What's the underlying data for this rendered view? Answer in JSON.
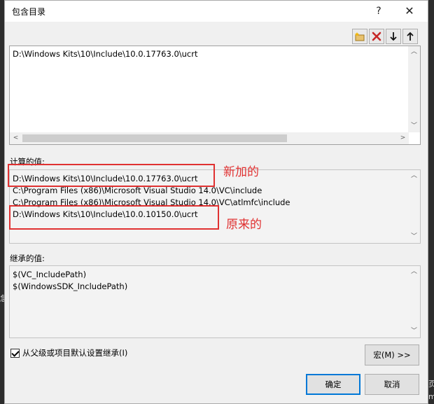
{
  "window": {
    "title": "包含目录",
    "help_label": "?",
    "close_label": "✕"
  },
  "toolbar": [
    {
      "name": "new-line-icon",
      "glyph": "✶"
    },
    {
      "name": "delete-icon",
      "glyph": "✕"
    },
    {
      "name": "move-down-icon",
      "glyph": "↓"
    },
    {
      "name": "move-up-icon",
      "glyph": "↑"
    }
  ],
  "editor": {
    "lines": [
      "D:\\Windows Kits\\10\\Include\\10.0.17763.0\\ucrt"
    ]
  },
  "evaluated": {
    "label": "计算的值:",
    "lines": [
      "D:\\Windows Kits\\10\\Include\\10.0.17763.0\\ucrt",
      "C:\\Program Files (x86)\\Microsoft Visual Studio 14.0\\VC\\include",
      "C:\\Program Files (x86)\\Microsoft Visual Studio 14.0\\VC\\atlmfc\\include",
      "D:\\Windows Kits\\10\\Include\\10.0.10150.0\\ucrt"
    ]
  },
  "annotations": {
    "new_label": "新加的",
    "original_label": "原来的"
  },
  "inherited": {
    "label": "继承的值:",
    "lines": [
      "$(VC_IncludePath)",
      "$(WindowsSDK_IncludePath)"
    ]
  },
  "inherit_checkbox": {
    "label": "从父级或项目默认设置继承(I)",
    "checked": true
  },
  "buttons": {
    "macros": "宏(M) >>",
    "ok": "确定",
    "cancel": "取消"
  },
  "background": {
    "left_char": "急",
    "right_chars": [
      "页",
      "ma"
    ]
  },
  "colors": {
    "annotation": "#e03131",
    "accent": "#0078d7"
  }
}
